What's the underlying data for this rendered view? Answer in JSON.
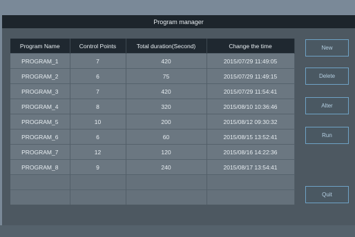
{
  "window": {
    "title": "Program manager"
  },
  "table": {
    "headers": [
      "Program Name",
      "Control Points",
      "Total duration(Second)",
      "Change the time"
    ],
    "rows": [
      [
        "PROGRAM_1",
        "7",
        "420",
        "2015/07/29  11:49:05"
      ],
      [
        "PROGRAM_2",
        "6",
        "75",
        "2015/07/29  11:49:15"
      ],
      [
        "PROGRAM_3",
        "7",
        "420",
        "2015/07/29  11:54:41"
      ],
      [
        "PROGRAM_4",
        "8",
        "320",
        "2015/08/10  10:36:46"
      ],
      [
        "PROGRAM_5",
        "10",
        "200",
        "2015/08/12  09:30:32"
      ],
      [
        "PROGRAM_6",
        "6",
        "60",
        "2015/08/15  13:52:41"
      ],
      [
        "PROGRAM_7",
        "12",
        "120",
        "2015/08/16  14:22:36"
      ],
      [
        "PROGRAM_8",
        "9",
        "240",
        "2015/08/17  13:54:41"
      ]
    ]
  },
  "buttons": {
    "new": "New",
    "delete": "Delete",
    "alter": "Alter",
    "run": "Run",
    "quit": "Quit"
  },
  "colors": {
    "titlebar": "#1d252c",
    "panel": "#4d5861",
    "button_border": "#6fa3c6",
    "row": "#6b7781"
  }
}
